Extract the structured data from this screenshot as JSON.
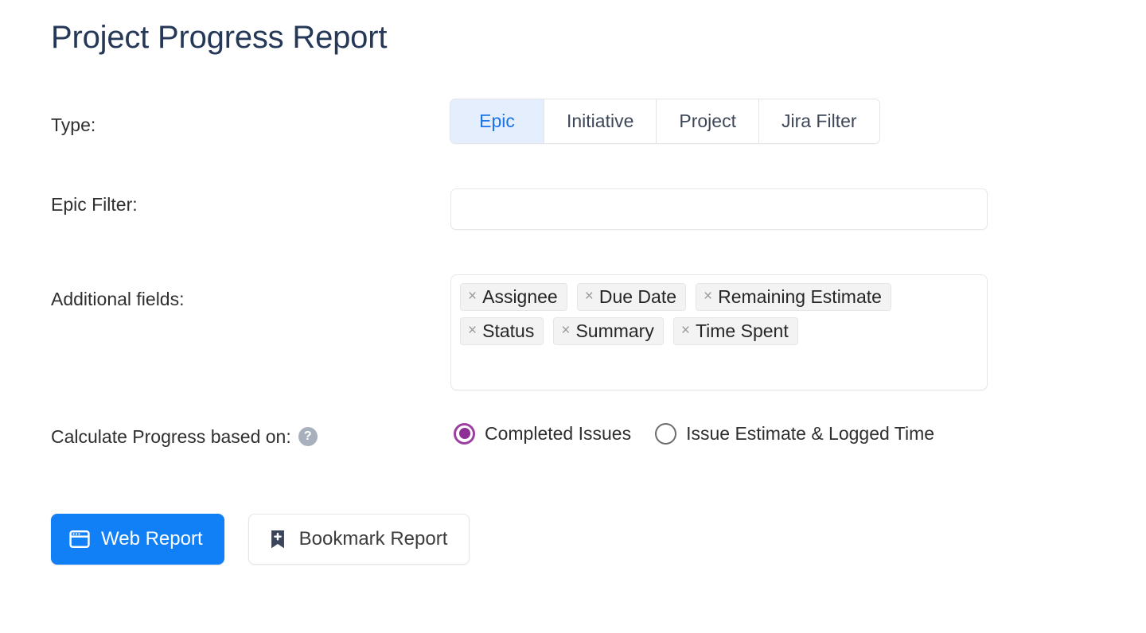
{
  "page": {
    "title": "Project Progress Report",
    "background": "#ffffff",
    "title_color": "#253858"
  },
  "type_row": {
    "label": "Type:",
    "tabs": [
      {
        "label": "Epic",
        "active": true
      },
      {
        "label": "Initiative",
        "active": false
      },
      {
        "label": "Project",
        "active": false
      },
      {
        "label": "Jira Filter",
        "active": false
      }
    ],
    "active_tab_bg": "#e4eefc",
    "active_tab_color": "#1a73e8"
  },
  "epic_filter_row": {
    "label": "Epic Filter:",
    "value": "",
    "placeholder": ""
  },
  "additional_fields_row": {
    "label": "Additional fields:",
    "chips": [
      {
        "remove_icon": "×",
        "label": "Assignee"
      },
      {
        "remove_icon": "×",
        "label": "Due Date"
      },
      {
        "remove_icon": "×",
        "label": "Remaining Estimate"
      },
      {
        "remove_icon": "×",
        "label": "Status"
      },
      {
        "remove_icon": "×",
        "label": "Summary"
      },
      {
        "remove_icon": "×",
        "label": "Time Spent"
      }
    ]
  },
  "calculate_progress_row": {
    "label": "Calculate Progress based on:",
    "help_icon": "question-mark-icon",
    "help_glyph": "?",
    "options": [
      {
        "label": "Completed Issues",
        "selected": true
      },
      {
        "label": "Issue Estimate & Logged Time",
        "selected": false
      }
    ],
    "selected_color": "#8f2f95"
  },
  "actions": {
    "web_report": {
      "label": "Web Report",
      "icon": "browser-window-icon",
      "bg": "#1180f7",
      "color": "#ffffff"
    },
    "bookmark_report": {
      "label": "Bookmark Report",
      "icon": "bookmark-plus-icon",
      "bg": "#ffffff",
      "color": "#3d3d3d"
    }
  }
}
